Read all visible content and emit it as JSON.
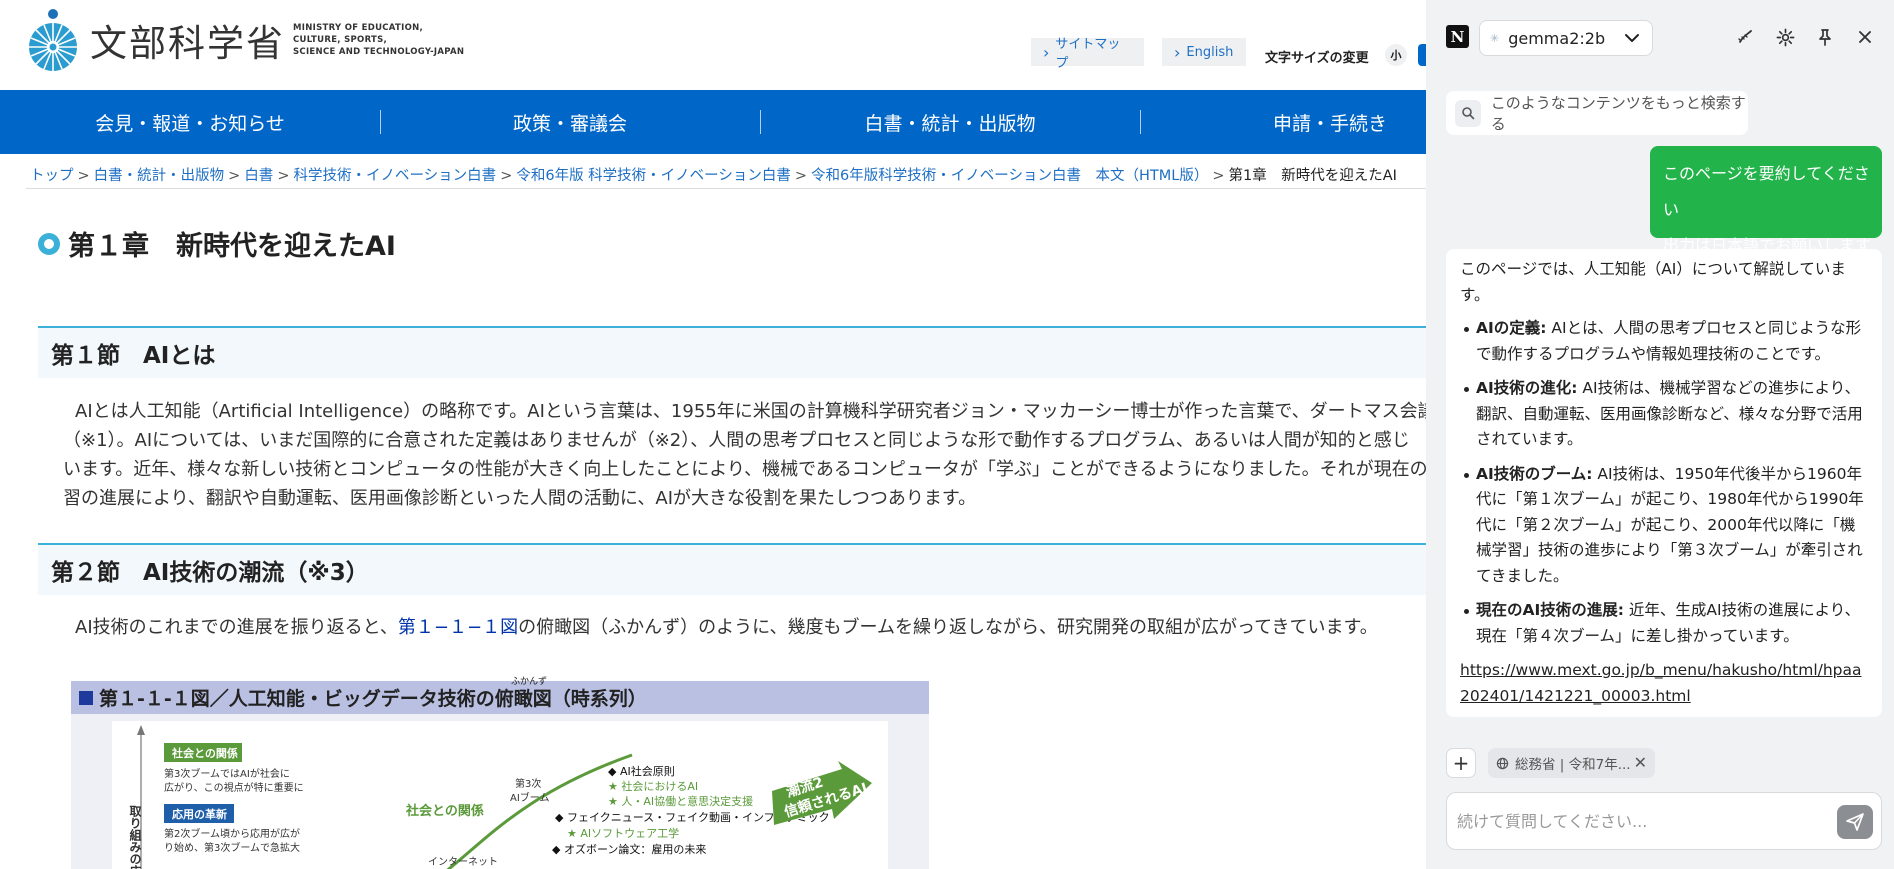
{
  "site": {
    "logo": {
      "title": "文部科学省",
      "en_line1": "MINISTRY OF EDUCATION,",
      "en_line2": "CULTURE, SPORTS,",
      "en_line3": "SCIENCE AND TECHNOLOGY-JAPAN"
    },
    "header_links": [
      "サイトマップ",
      "English"
    ],
    "font_size": {
      "label": "文字サイズの変更",
      "small": "小"
    },
    "global_nav": [
      "会見・報道・お知らせ",
      "政策・審議会",
      "白書・統計・出版物",
      "申請・手続き"
    ],
    "breadcrumb": {
      "links": [
        "トップ",
        "白書・統計・出版物",
        "白書",
        "科学技術・イノベーション白書",
        "令和6年版 科学技術・イノベーション白書",
        "令和6年版科学技術・イノベーション白書　本文（HTML版）"
      ],
      "current": "第1章　新時代を迎えたAI",
      "separator": ">"
    },
    "chapter_title": "第１章　新時代を迎えたAI",
    "section1": {
      "heading": "第１節　AIとは",
      "lines": [
        "AIとは人工知能（Artificial Intelligence）の略称です。AIという言葉は、1955年に米国の計算機科学研究者ジョン・マッカーシー博士が作った言葉で、ダートマス会議で",
        "（※1）。AIについては、いまだ国際的に合意された定義はありませんが（※2）、人間の思考プロセスと同じような形で動作するプログラム、あるいは人間が知的と感じ",
        "います。近年、様々な新しい技術とコンピュータの性能が大きく向上したことにより、機械であるコンピュータが「学ぶ」ことができるようになりました。それが現在のAIの",
        "習の進展により、翻訳や自動運転、医用画像診断といった人間の活動に、AIが大きな役割を果たしつつあります。"
      ]
    },
    "section2": {
      "heading": "第２節　AI技術の潮流（※3）",
      "para_before": "AI技術のこれまでの進展を振り返ると、",
      "para_link": "第１−１−１図",
      "para_after": "の俯瞰図（ふかんず）のように、幾度もブームを繰り返しながら、研究開発の取組が広がってきています。"
    },
    "figure": {
      "title": "第１-１-１図／人工知能・ビッグデータ技術の俯瞰図（時系列）",
      "ruby": "ふかんず",
      "y_axis_label": "取り組みの広",
      "box1_title": "社会との関係",
      "box1_text": [
        "第3次ブームではAIが社会に",
        "広がり、この視点が特に重要に"
      ],
      "box2_title": "応用の革新",
      "box2_text": [
        "第2次ブーム頃から応用が広が",
        "り始め、第3次ブームで急拡大"
      ],
      "curve_label": "社会との関係",
      "boom_label": [
        "第3次",
        "AIブーム"
      ],
      "internet_label": "インターネット",
      "items": [
        "◆ AI社会原則",
        "★ 社会におけるAI",
        "★ 人・AI協働と意思決定支援",
        "◆ フェイクニュース・フェイク動画・インフォデミック",
        "★ AIソフトウェア工学",
        "◆ オズボーン論文：雇用の未来"
      ],
      "trend_label": [
        "潮流2",
        "信頼されるAI"
      ]
    }
  },
  "sidebar": {
    "logo": "N",
    "model": "gemma2:2b",
    "suggestion": "このようなコンテンツをもっと検索する",
    "user_message": [
      "このページを要約してください",
      "出力は日本語でお願いします"
    ],
    "answer": {
      "intro": "このページでは、人工知能（AI）について解説しています。",
      "bullets": [
        {
          "title": "AIの定義:",
          "text": " AIとは、人間の思考プロセスと同じような形で動作するプログラムや情報処理技術のことです。"
        },
        {
          "title": "AI技術の進化:",
          "text": " AI技術は、機械学習などの進歩により、翻訳、自動運転、医用画像診断など、様々な分野で活用されています。"
        },
        {
          "title": "AI技術のブーム:",
          "text": " AI技術は、1950年代後半から1960年代に「第１次ブーム」が起こり、1980年代から1990年代に「第２次ブーム」が起こり、2000年代以降に「機械学習」技術の進歩により「第３次ブーム」が牽引されてきました。"
        },
        {
          "title": "現在のAI技術の進展:",
          "text": " 近年、生成AI技術の進展により、現在「第４次ブーム」に差し掛かっています。"
        }
      ],
      "link": "https://www.mext.go.jp/b_menu/hakusho/html/hpaa202401/1421221_00003.html"
    },
    "context_chip": "総務省 | 令和7年...",
    "input_placeholder": "続けて質問してください..."
  }
}
